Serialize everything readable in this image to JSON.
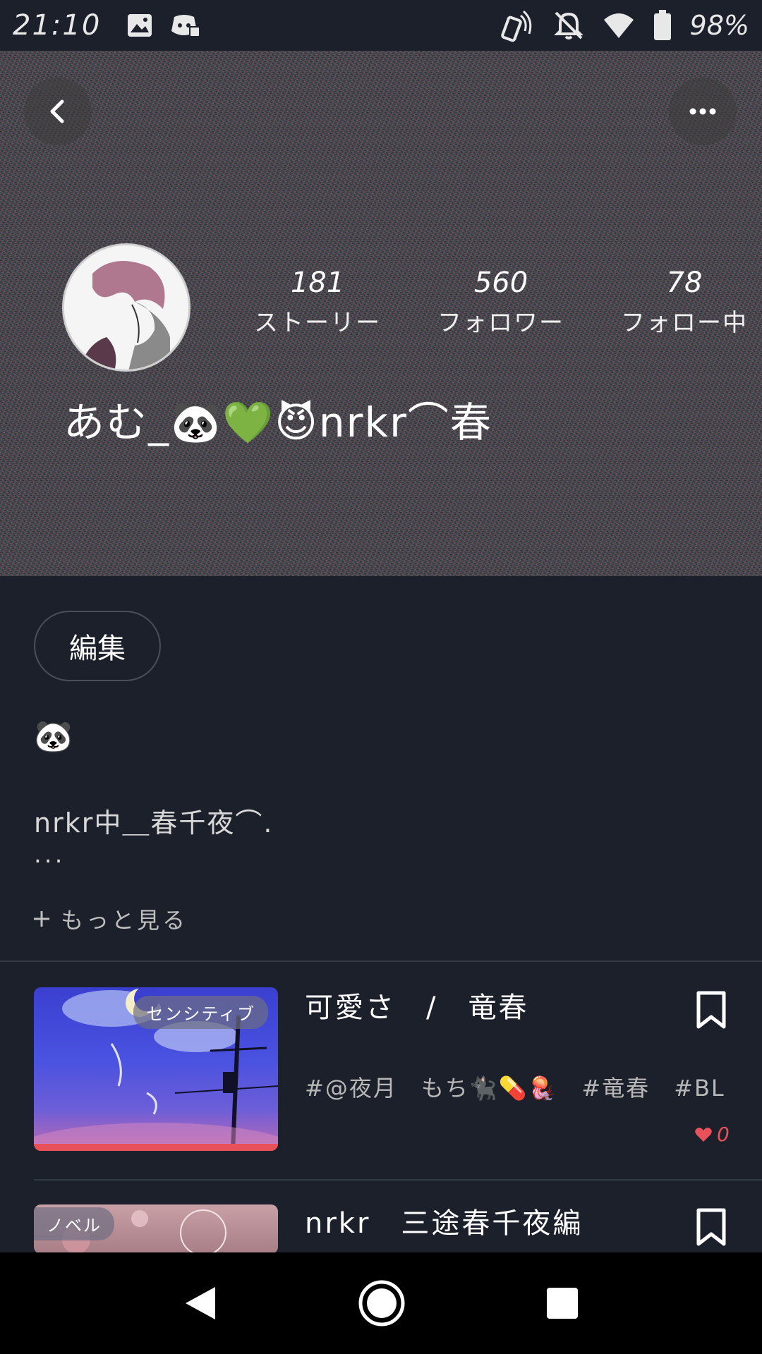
{
  "status_bar": {
    "time": "21:10",
    "battery": "98%",
    "icons": [
      "image-icon",
      "discord-icon",
      "nfc-icon",
      "bell-off-icon",
      "wifi-icon",
      "battery-icon"
    ]
  },
  "header": {
    "back_icon": "back-arrow-icon",
    "menu_icon": "more-dots-icon"
  },
  "profile": {
    "name": "あむ_🐼💚😈nrkr⌒春",
    "stats": [
      {
        "value": "181",
        "label": "ストーリー"
      },
      {
        "value": "560",
        "label": "フォロワー"
      },
      {
        "value": "78",
        "label": "フォロー中"
      }
    ],
    "edit_label": "編集",
    "bio_emoji": "🐼",
    "bio_text": "nrkr中＿春千夜⌒.",
    "bio_ellipsis": "...",
    "more_label": "もっと見る"
  },
  "stories": [
    {
      "title": "可愛さ　/　竜春",
      "badge": "センシティブ",
      "tags": "#@夜月　もち🐈‍⬛💊🪼　#竜春　#BL",
      "likes": "0"
    },
    {
      "title": "nrkr　三途春千夜編",
      "badge": "ノベル"
    }
  ],
  "colors": {
    "background": "#1b202a",
    "accent_red": "#e8505a",
    "divider": "#333a46"
  }
}
